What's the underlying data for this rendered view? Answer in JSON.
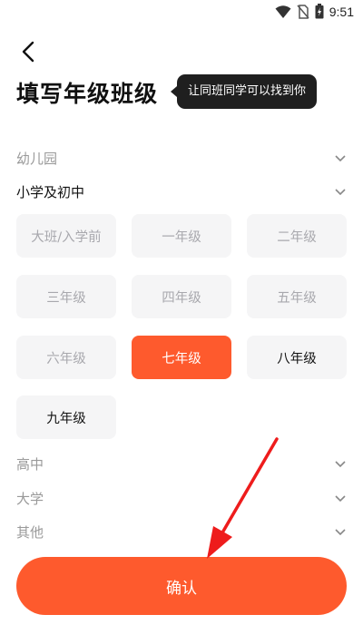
{
  "status_bar": {
    "time": "9:51"
  },
  "header": {
    "title": "填写年级班级",
    "tooltip": "让同班同学可以找到你"
  },
  "sections": {
    "kindergarten": "幼儿园",
    "primary_middle": "小学及初中",
    "high_school": "高中",
    "university": "大学",
    "other": "其他"
  },
  "grades": [
    {
      "label": "大班/入学前",
      "state": "disabled"
    },
    {
      "label": "一年级",
      "state": "disabled"
    },
    {
      "label": "二年级",
      "state": "disabled"
    },
    {
      "label": "三年级",
      "state": "disabled"
    },
    {
      "label": "四年级",
      "state": "disabled"
    },
    {
      "label": "五年级",
      "state": "disabled"
    },
    {
      "label": "六年级",
      "state": "disabled"
    },
    {
      "label": "七年级",
      "state": "selected"
    },
    {
      "label": "八年级",
      "state": "available"
    },
    {
      "label": "九年级",
      "state": "available"
    }
  ],
  "confirm_label": "确认",
  "colors": {
    "accent": "#fe5a2d",
    "tooltip_bg": "#1f1f1f"
  },
  "icons": [
    "wifi-icon",
    "no-sim-icon",
    "battery-icon",
    "back-arrow-icon",
    "chevron-down-icon"
  ]
}
